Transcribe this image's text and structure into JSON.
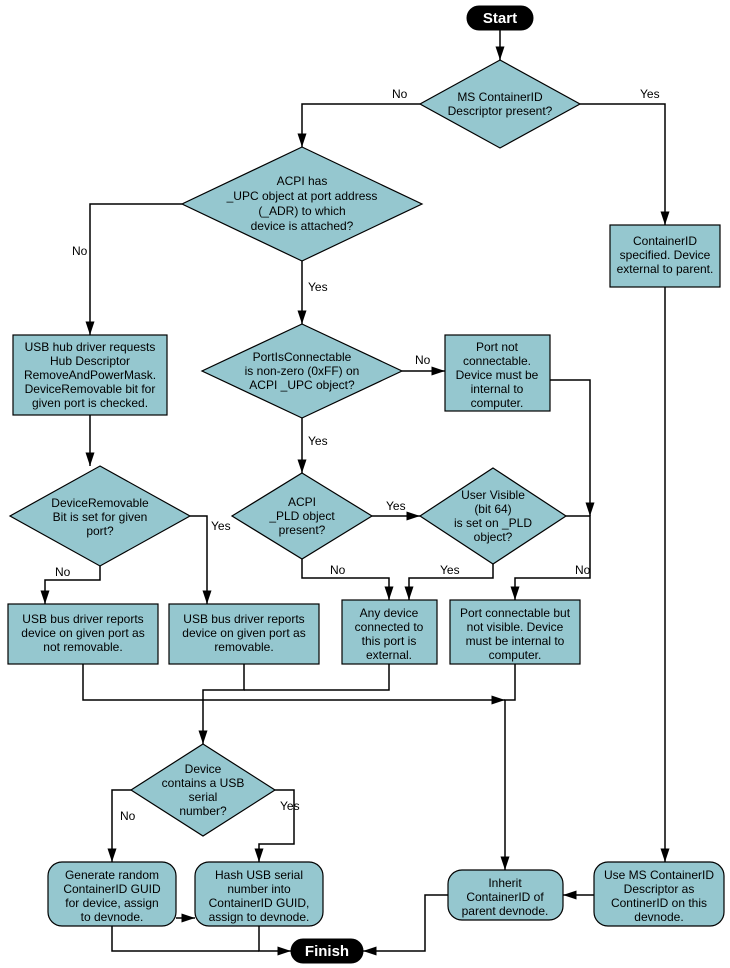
{
  "terminators": {
    "start": "Start",
    "finish": "Finish"
  },
  "decisions": {
    "d1": [
      "MS ContainerID",
      "Descriptor present?"
    ],
    "d2": [
      "ACPI has",
      "_UPC object at port address",
      "(_ADR) to which",
      "device is attached?"
    ],
    "d3": [
      "PortIsConnectable",
      "is non-zero (0xFF) on",
      "ACPI _UPC object?"
    ],
    "d4": [
      "DeviceRemovable",
      "Bit is set for given",
      "port?"
    ],
    "d5": [
      "ACPI",
      "_PLD object",
      "present?"
    ],
    "d6": [
      "User Visible",
      "(bit 64)",
      "is set on _PLD",
      "object?"
    ],
    "d7": [
      "Device",
      "contains a USB",
      "serial",
      "number?"
    ]
  },
  "processes": {
    "p_cid_spec": [
      "ContainerID",
      "specified. Device",
      "external to parent."
    ],
    "p_hubreq": [
      "USB hub driver requests",
      "Hub Descriptor",
      "RemoveAndPowerMask.",
      "DeviceRemovable bit for",
      "given port is checked."
    ],
    "p_portnotconn": [
      "Port not",
      "connectable.",
      "Device must be",
      "internal to",
      "computer."
    ],
    "p_notremovable": [
      "USB bus driver reports",
      "device on given port as",
      "not removable."
    ],
    "p_removable": [
      "USB bus driver reports",
      "device on given port as",
      "removable."
    ],
    "p_anyext": [
      "Any device",
      "connected to",
      "this port is",
      "external."
    ],
    "p_connnotvis": [
      "Port connectable but",
      "not visible. Device",
      "must be internal to",
      "computer."
    ]
  },
  "rounded": {
    "r_genrandom": [
      "Generate random",
      "ContainerID GUID",
      "for device, assign",
      "to devnode."
    ],
    "r_hash": [
      "Hash USB serial",
      "number into",
      "ContainerID GUID,",
      "assign to devnode."
    ],
    "r_inherit": [
      "Inherit",
      "ContainerID of",
      "parent devnode."
    ],
    "r_usems": [
      "Use MS ContainerID",
      "Descriptor as",
      "ContinerID on this",
      "devnode."
    ]
  },
  "edgelabels": {
    "yes": "Yes",
    "no": "No"
  }
}
